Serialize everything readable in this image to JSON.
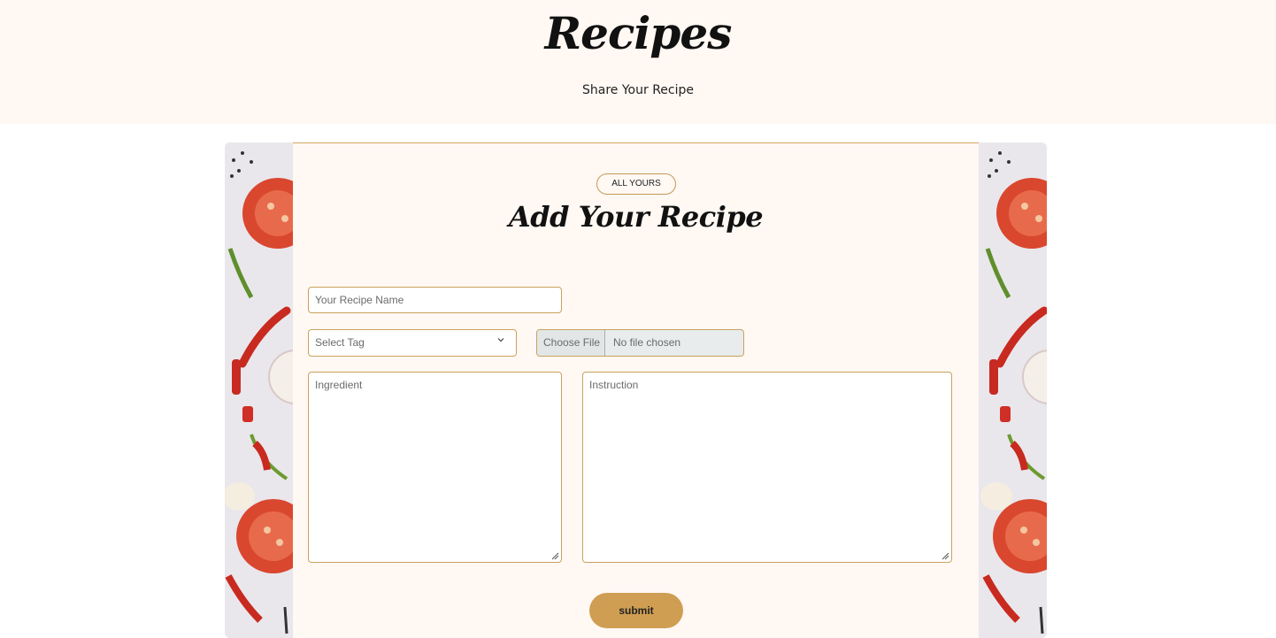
{
  "header": {
    "title": "Recipes",
    "subtitle": "Share Your Recipe"
  },
  "form": {
    "badge": "ALL YOURS",
    "title": "Add Your Recipe",
    "recipe_name": {
      "placeholder": "Your Recipe Name",
      "value": ""
    },
    "tag_select": {
      "selected": "Select Tag"
    },
    "file_input": {
      "button_label": "Choose File",
      "status": "No file chosen"
    },
    "ingredient": {
      "placeholder": "Ingredient",
      "value": ""
    },
    "instruction": {
      "placeholder": "Instruction",
      "value": ""
    },
    "submit_label": "submit"
  },
  "colors": {
    "hero_bg": "#fff8f3",
    "accent": "#cf9e52",
    "field_border": "#c9a25c"
  },
  "icons": {
    "select_arrow": "chevron-down-icon",
    "resize_handle": "resize-grip-icon"
  }
}
